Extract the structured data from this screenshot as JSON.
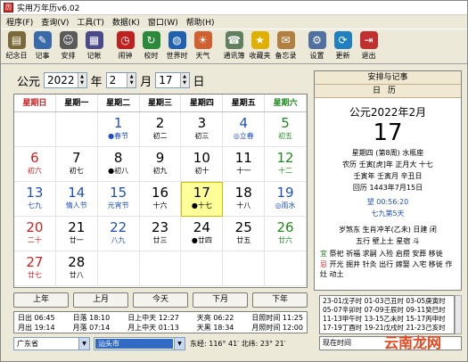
{
  "window": {
    "title": "实用万年历v6.02"
  },
  "menu": [
    "程序(F)",
    "查询(V)",
    "工具(T)",
    "数据(K)",
    "窗口(W)",
    "帮助(H)"
  ],
  "toolbar": [
    {
      "label": "纪念日",
      "icon": "calendar-book-icon",
      "color": "#7a6a3a"
    },
    {
      "label": "记事",
      "icon": "notebook-icon",
      "color": "#3a6aa8"
    },
    {
      "label": "安排",
      "icon": "person-schedule-icon",
      "color": "#5a5a5a"
    },
    {
      "label": "记帐",
      "icon": "ledger-icon",
      "color": "#4a4a8a"
    },
    {
      "label": "闹钟",
      "icon": "alarm-clock-icon",
      "color": "#c02020"
    },
    {
      "label": "校时",
      "icon": "clock-sync-icon",
      "color": "#2a8a3a"
    },
    {
      "label": "世界时",
      "icon": "globe-icon",
      "color": "#2060b0"
    },
    {
      "label": "天气",
      "icon": "weather-icon",
      "color": "#d06030"
    },
    {
      "label": "通讯簿",
      "icon": "address-book-icon",
      "color": "#608060"
    },
    {
      "label": "收藏夹",
      "icon": "star-icon",
      "color": "#e0b000"
    },
    {
      "label": "备忘录",
      "icon": "memo-icon",
      "color": "#b08040"
    },
    {
      "label": "设置",
      "icon": "settings-icon",
      "color": "#5070a0"
    },
    {
      "label": "更新",
      "icon": "update-icon",
      "color": "#2080c0"
    },
    {
      "label": "退出",
      "icon": "exit-icon",
      "color": "#c03030"
    }
  ],
  "datebar": {
    "prefix": "公元",
    "year": "2022",
    "year_unit": "年",
    "month": "2",
    "month_unit": "月",
    "day": "17",
    "day_unit": "日"
  },
  "weekdays": [
    "星期日",
    "星期一",
    "星期二",
    "星期三",
    "星期四",
    "星期五",
    "星期六"
  ],
  "colors": {
    "red": "#d02020",
    "green": "#208a20",
    "blue": "#2050c0",
    "black": "#000000"
  },
  "days": [
    {
      "d": "",
      "l": ""
    },
    {
      "d": "",
      "l": ""
    },
    {
      "d": "1",
      "l": "●春节",
      "dc": "blue",
      "lc": "blue"
    },
    {
      "d": "2",
      "l": "初二"
    },
    {
      "d": "3",
      "l": "初三"
    },
    {
      "d": "4",
      "l": "◎立春",
      "dc": "blue",
      "lc": "blue"
    },
    {
      "d": "5",
      "l": "初五",
      "dc": "green",
      "lc": "green"
    },
    {
      "d": "6",
      "l": "初六",
      "dc": "red",
      "lc": "red"
    },
    {
      "d": "7",
      "l": "初七"
    },
    {
      "d": "8",
      "l": "●初八"
    },
    {
      "d": "9",
      "l": "初九"
    },
    {
      "d": "10",
      "l": "初十"
    },
    {
      "d": "11",
      "l": "十一"
    },
    {
      "d": "12",
      "l": "十二",
      "dc": "green",
      "lc": "green"
    },
    {
      "d": "13",
      "l": "七九",
      "dc": "blue",
      "lc": "blue"
    },
    {
      "d": "14",
      "l": "情人节",
      "dc": "blue",
      "lc": "blue"
    },
    {
      "d": "15",
      "l": "元宵节",
      "dc": "blue",
      "lc": "blue"
    },
    {
      "d": "16",
      "l": "十六"
    },
    {
      "d": "17",
      "l": "●十七",
      "today": true
    },
    {
      "d": "18",
      "l": "十八"
    },
    {
      "d": "19",
      "l": "◎雨水",
      "dc": "blue",
      "lc": "blue"
    },
    {
      "d": "20",
      "l": "二十",
      "dc": "red",
      "lc": "red"
    },
    {
      "d": "21",
      "l": "廿一"
    },
    {
      "d": "22",
      "l": "八九",
      "dc": "blue",
      "lc": "blue"
    },
    {
      "d": "23",
      "l": "廿三"
    },
    {
      "d": "24",
      "l": "●廿四"
    },
    {
      "d": "25",
      "l": "廿五"
    },
    {
      "d": "26",
      "l": "廿六",
      "dc": "green",
      "lc": "green"
    },
    {
      "d": "27",
      "l": "廿七",
      "dc": "red",
      "lc": "red"
    },
    {
      "d": "28",
      "l": "廿八"
    },
    {
      "d": "",
      "l": ""
    },
    {
      "d": "",
      "l": ""
    },
    {
      "d": "",
      "l": ""
    },
    {
      "d": "",
      "l": ""
    },
    {
      "d": "",
      "l": ""
    }
  ],
  "nav": [
    "上年",
    "上月",
    "今天",
    "下月",
    "下年"
  ],
  "sun": {
    "row1": [
      "日出 06:45",
      "日落 18:10",
      "日上中天 12:27",
      "天亮 06:22",
      "日照时间 11:25"
    ],
    "row2": [
      "月出 19:14",
      "月落 07:14",
      "月上中天 01:13",
      "天黑 18:34",
      "月照时间 12:00"
    ]
  },
  "location": {
    "province": "广东省",
    "city": "汕头市",
    "coords": "东经: 116° 41′ 北纬: 23° 21′"
  },
  "right": {
    "header1": "安排与记事",
    "header2": "日历",
    "ym": "公元2022年2月",
    "day": "17",
    "week": "星期四 (第8周) 水瓶座",
    "lunar": "农历 壬寅[虎]年 正月大 十七",
    "ganzhi": "壬寅年 壬寅月 辛丑日",
    "islamic": "回历 1443年7月15日",
    "moon": "望 00:56:20",
    "nine": "七九第5天",
    "sui": "岁煞东 生肖冲羊(乙未) 日建 闭",
    "wuxing": "五行 壁上土 星宿 斗",
    "yi_label": "宜",
    "yi": "祭祀 祈福 求嗣 入殓 启攒 安葬 移徙",
    "ji_label": "忌",
    "ji": "开光 掘井 针灸 出行 嫁娶 入宅 移徙 作灶 动土"
  },
  "jieqi": [
    "23-01戊子时 01-03己丑时 03-05庚寅时",
    "05-07辛卯时 07-09壬辰时 09-11癸巳时",
    "11-13甲午时 13-15乙未时 15-17丙申时",
    "17-19丁酉时 19-21戊戌时 21-23己亥时"
  ],
  "now_label": "现在时间",
  "watermark": "云南龙网"
}
